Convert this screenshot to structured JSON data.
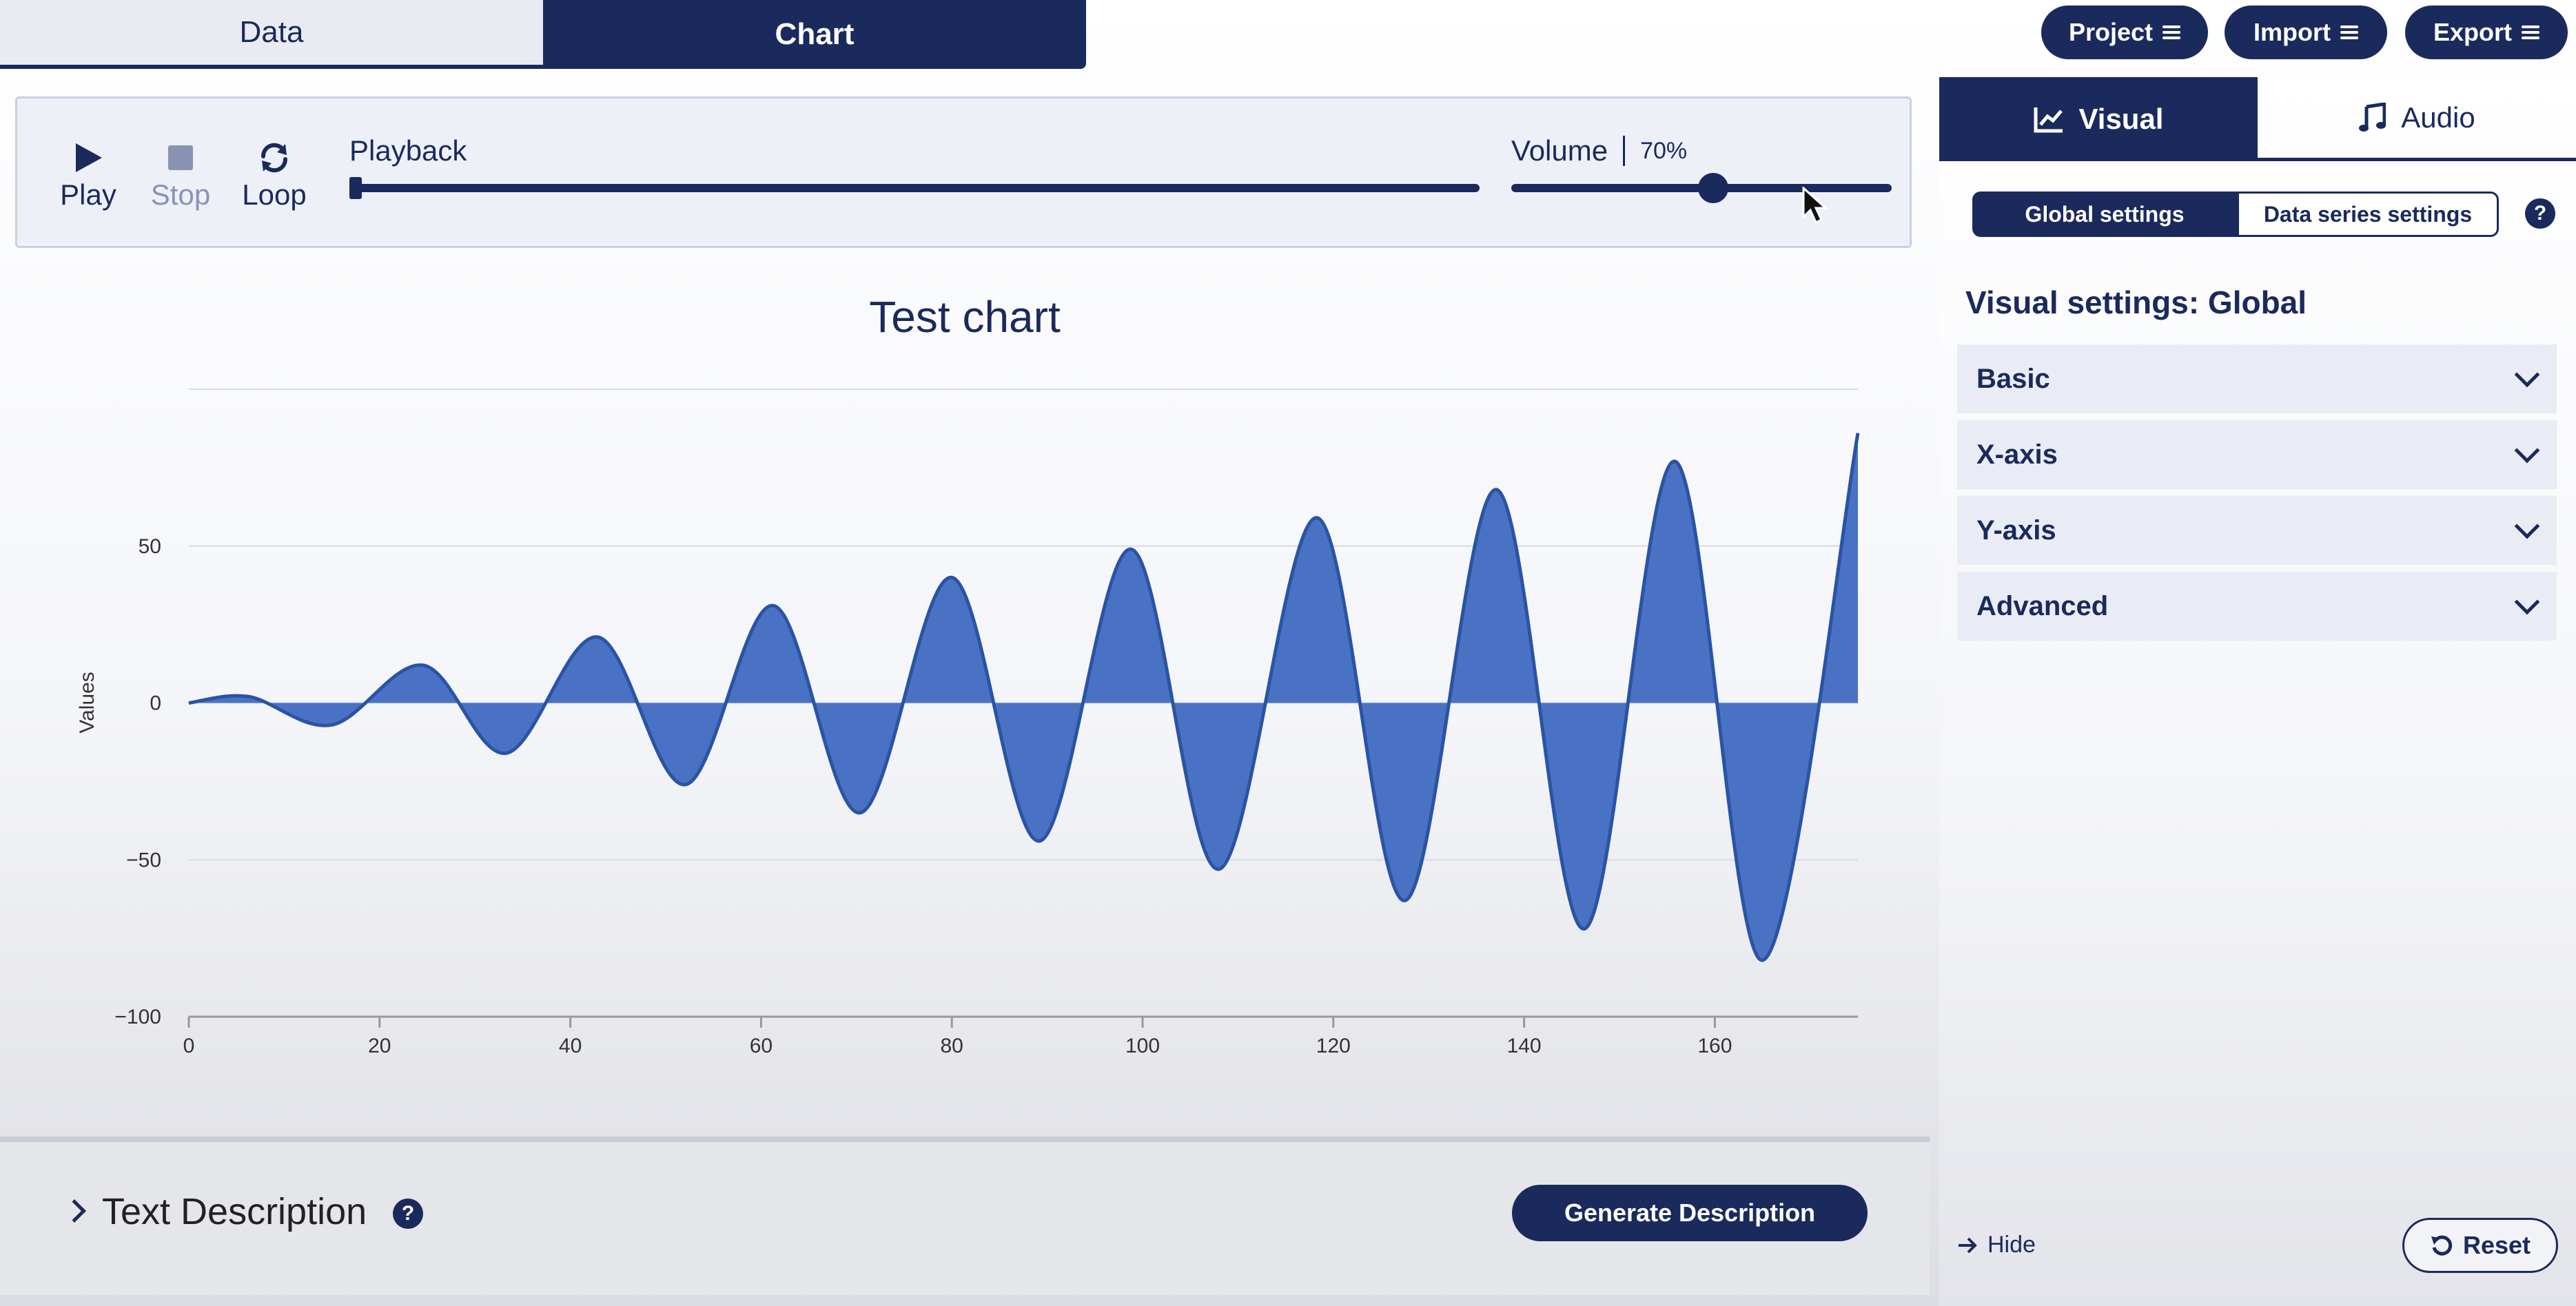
{
  "top_tabs": {
    "data": "Data",
    "chart": "Chart"
  },
  "menus": {
    "project": "Project",
    "import": "Import",
    "export": "Export"
  },
  "playback": {
    "play": "Play",
    "stop": "Stop",
    "loop": "Loop",
    "playback_label": "Playback",
    "playback_position": 0,
    "volume_label": "Volume",
    "volume_value": "70%",
    "volume_level": 0.53
  },
  "chart_data": {
    "type": "area",
    "title": "Test chart",
    "xlabel": "",
    "ylabel": "Values",
    "xlim": [
      0,
      175
    ],
    "ylim": [
      -100,
      100
    ],
    "x_ticks": [
      0,
      20,
      40,
      60,
      80,
      100,
      120,
      140,
      160
    ],
    "y_ticks": [
      50,
      0,
      -50,
      -100
    ],
    "grid": true,
    "series": [
      {
        "color": "#4a72c4",
        "stroke": "#2a54a3",
        "x": [
          0,
          6.3,
          15.0,
          24.6,
          33.3,
          42.9,
          52.1,
          61.3,
          70.4,
          80.0,
          89.2,
          98.8,
          108.0,
          118.3,
          127.5,
          137.1,
          146.3,
          155.8,
          165.0,
          175.0
        ],
        "y": [
          0,
          2,
          -7,
          12,
          -16,
          21,
          -26,
          31,
          -35,
          40,
          -44,
          49,
          -53,
          59,
          -63,
          68,
          -72,
          77,
          -82,
          86
        ]
      }
    ]
  },
  "description": {
    "title": "Text Description",
    "help": "?",
    "generate": "Generate Description"
  },
  "side": {
    "tabs": {
      "visual": "Visual",
      "audio": "Audio"
    },
    "seg": {
      "global": "Global settings",
      "series": "Data series settings",
      "help": "?"
    },
    "heading": "Visual settings: Global",
    "sections": [
      "Basic",
      "X-axis",
      "Y-axis",
      "Advanced"
    ],
    "hide": "Hide",
    "reset": "Reset"
  },
  "colors": {
    "navy": "#1b2a5c",
    "fill": "#4a72c4"
  }
}
